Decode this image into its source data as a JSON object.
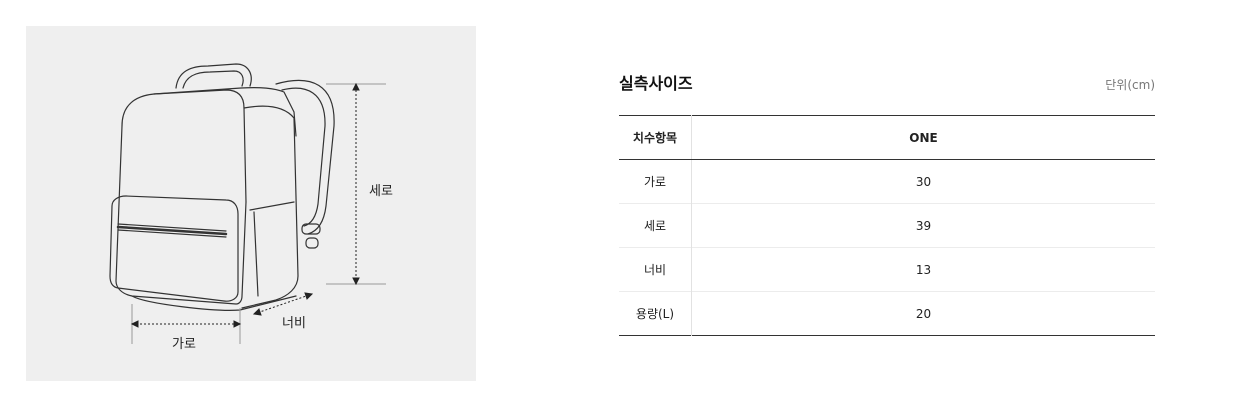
{
  "diagram": {
    "labels": {
      "width": "가로",
      "height": "세로",
      "depth": "너비"
    }
  },
  "size_panel": {
    "title": "실측사이즈",
    "unit": "단위(cm)",
    "table": {
      "header_label": "치수항목",
      "column": "ONE",
      "rows": [
        {
          "label": "가로",
          "value": "30"
        },
        {
          "label": "세로",
          "value": "39"
        },
        {
          "label": "너비",
          "value": "13"
        },
        {
          "label": "용량(L)",
          "value": "20"
        }
      ]
    }
  }
}
